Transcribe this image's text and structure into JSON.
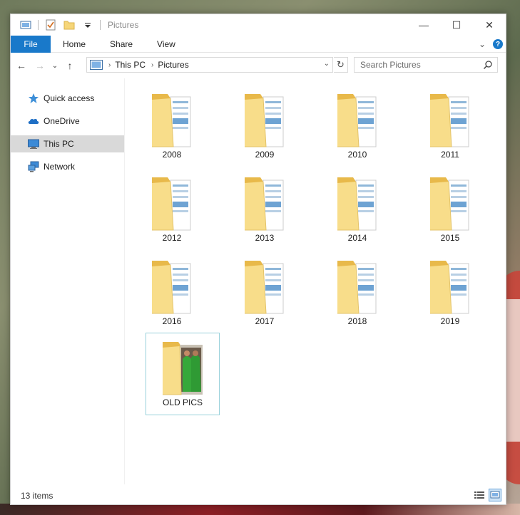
{
  "window": {
    "title": "Pictures"
  },
  "controls": {
    "minimize": "—",
    "maximize": "☐",
    "close": "✕"
  },
  "ribbon": {
    "tabs": [
      "File",
      "Home",
      "Share",
      "View"
    ],
    "expand_glyph": "⌄",
    "help": "?"
  },
  "nav": {
    "back": "←",
    "forward": "→",
    "recent": "⌄",
    "up": "↑",
    "refresh": "↻",
    "dropdown": "⌄"
  },
  "breadcrumb": [
    "This PC",
    "Pictures"
  ],
  "search": {
    "placeholder": "Search Pictures"
  },
  "sidebar": {
    "items": [
      {
        "label": "Quick access",
        "icon": "star-icon"
      },
      {
        "label": "OneDrive",
        "icon": "cloud-icon"
      },
      {
        "label": "This PC",
        "icon": "computer-icon",
        "selected": true
      },
      {
        "label": "Network",
        "icon": "network-icon"
      }
    ]
  },
  "folders": [
    "2008",
    "2009",
    "2010",
    "2011",
    "2012",
    "2013",
    "2014",
    "2015",
    "2016",
    "2017",
    "2018",
    "2019",
    "OLD PICS"
  ],
  "status": {
    "item_count": "13 items"
  },
  "colors": {
    "accent": "#1979ca",
    "folder": "#f6d679",
    "selection": "#99d1db"
  }
}
